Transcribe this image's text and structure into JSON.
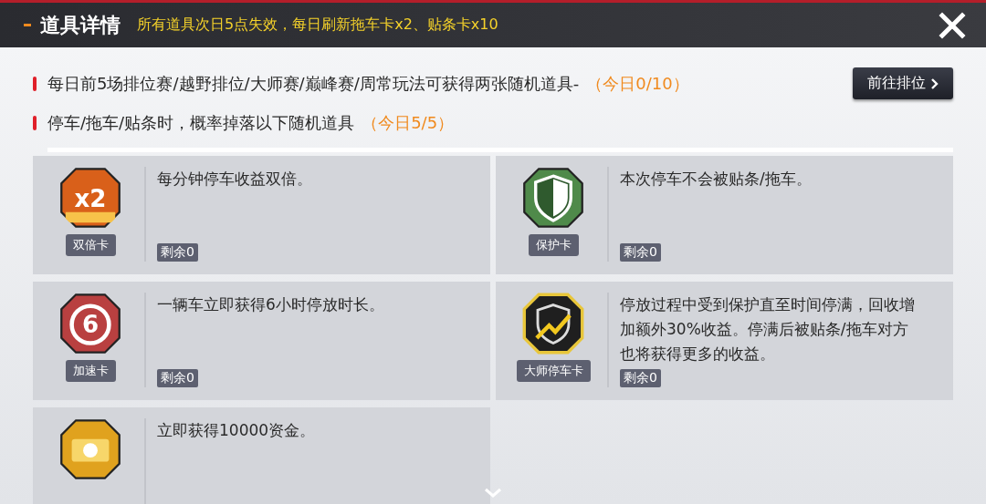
{
  "header": {
    "title": "道具详情",
    "notice": "所有道具次日5点失效，每日刷新拖车卡x2、贴条卡x10"
  },
  "info_rows": [
    {
      "text": "每日前5场排位赛/越野排位/大师赛/巅峰赛/周常玩法可获得两张随机道具-",
      "count": "（今日0/10）",
      "button": "前往排位"
    },
    {
      "text": "停车/拖车/贴条时，概率掉落以下随机道具",
      "count": "（今日5/5）"
    }
  ],
  "items": [
    {
      "kind": "double",
      "icon_text": "x2",
      "name": "双倍卡",
      "description": "每分钟停车收益双倍。",
      "remaining": "剩余0"
    },
    {
      "kind": "shield",
      "name": "保护卡",
      "description": "本次停车不会被贴条/拖车。",
      "remaining": "剩余0"
    },
    {
      "kind": "speed",
      "icon_text": "6",
      "name": "加速卡",
      "description": "一辆车立即获得6小时停放时长。",
      "remaining": "剩余0"
    },
    {
      "kind": "master",
      "name": "大师停车卡",
      "description": "停放过程中受到保护直至时间停满，回收增加额外30%收益。停满后被贴条/拖车对方也将获得更多的收益。",
      "remaining": "剩余0"
    },
    {
      "kind": "cash",
      "description": "立即获得10000资金。"
    }
  ]
}
